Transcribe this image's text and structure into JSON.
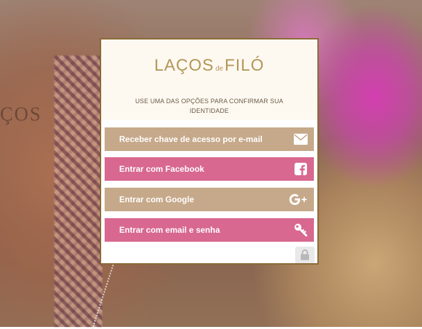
{
  "logo": {
    "part1": "LAÇOS",
    "part2": "de",
    "part3": "FILÓ"
  },
  "background": {
    "text": "ÇOS"
  },
  "instructions": "USE UMA DAS OPÇÕES PARA CONFIRMAR SUA IDENTIDADE",
  "buttons": {
    "email_key": "Receber chave de acesso por e-mail",
    "facebook": "Entrar com Facebook",
    "google": "Entrar com Google",
    "email_password": "Entrar com email e senha"
  },
  "icons": {
    "email_key": "envelope-icon",
    "facebook": "facebook-icon",
    "google": "google-plus-icon",
    "email_password": "key-icon",
    "lock": "lock-icon"
  },
  "colors": {
    "beige_button": "#c6a98a",
    "pink_button": "#d8688f",
    "gold_accent": "#b39556",
    "border": "#8a6a35"
  }
}
